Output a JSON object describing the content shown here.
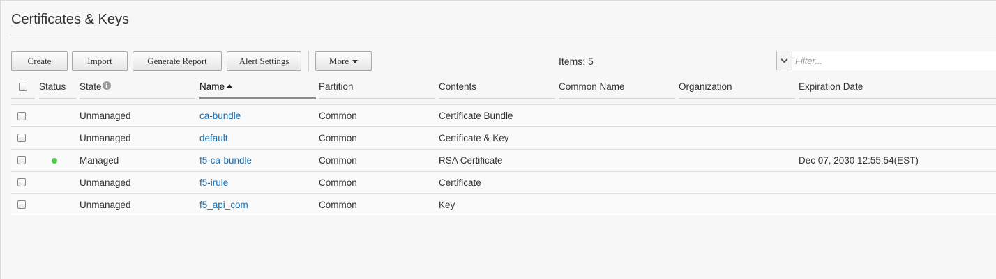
{
  "page": {
    "title": "Certificates & Keys"
  },
  "toolbar": {
    "create_label": "Create",
    "import_label": "Import",
    "report_label": "Generate Report",
    "alert_label": "Alert Settings",
    "more_label": "More",
    "items_count": "Items: 5",
    "filter_placeholder": "Filter..."
  },
  "columns": {
    "status": "Status",
    "state": "State",
    "name": "Name",
    "partition": "Partition",
    "contents": "Contents",
    "common_name": "Common Name",
    "organization": "Organization",
    "expiration": "Expiration Date"
  },
  "rows": [
    {
      "state": "Unmanaged",
      "name": "ca-bundle",
      "partition": "Common",
      "contents": "Certificate Bundle",
      "common_name": "",
      "organization": "",
      "expiration": "",
      "status": "none"
    },
    {
      "state": "Unmanaged",
      "name": "default",
      "partition": "Common",
      "contents": "Certificate & Key",
      "common_name": "",
      "organization": "",
      "expiration": "",
      "status": "none"
    },
    {
      "state": "Managed",
      "name": "f5-ca-bundle",
      "partition": "Common",
      "contents": "RSA Certificate",
      "common_name": "",
      "organization": "",
      "expiration": "Dec 07, 2030 12:55:54(EST)",
      "status": "green"
    },
    {
      "state": "Unmanaged",
      "name": "f5-irule",
      "partition": "Common",
      "contents": "Certificate",
      "common_name": "",
      "organization": "",
      "expiration": "",
      "status": "none"
    },
    {
      "state": "Unmanaged",
      "name": "f5_api_com",
      "partition": "Common",
      "contents": "Key",
      "common_name": "",
      "organization": "",
      "expiration": "",
      "status": "none"
    }
  ],
  "colors": {
    "link": "#1a6fb0",
    "status_green": "#4ec94e"
  },
  "icons": {
    "state_info": "info-icon",
    "sort": "sort-ascending-icon",
    "more_caret": "caret-down-icon",
    "filter_dropdown": "chevron-down-icon"
  }
}
